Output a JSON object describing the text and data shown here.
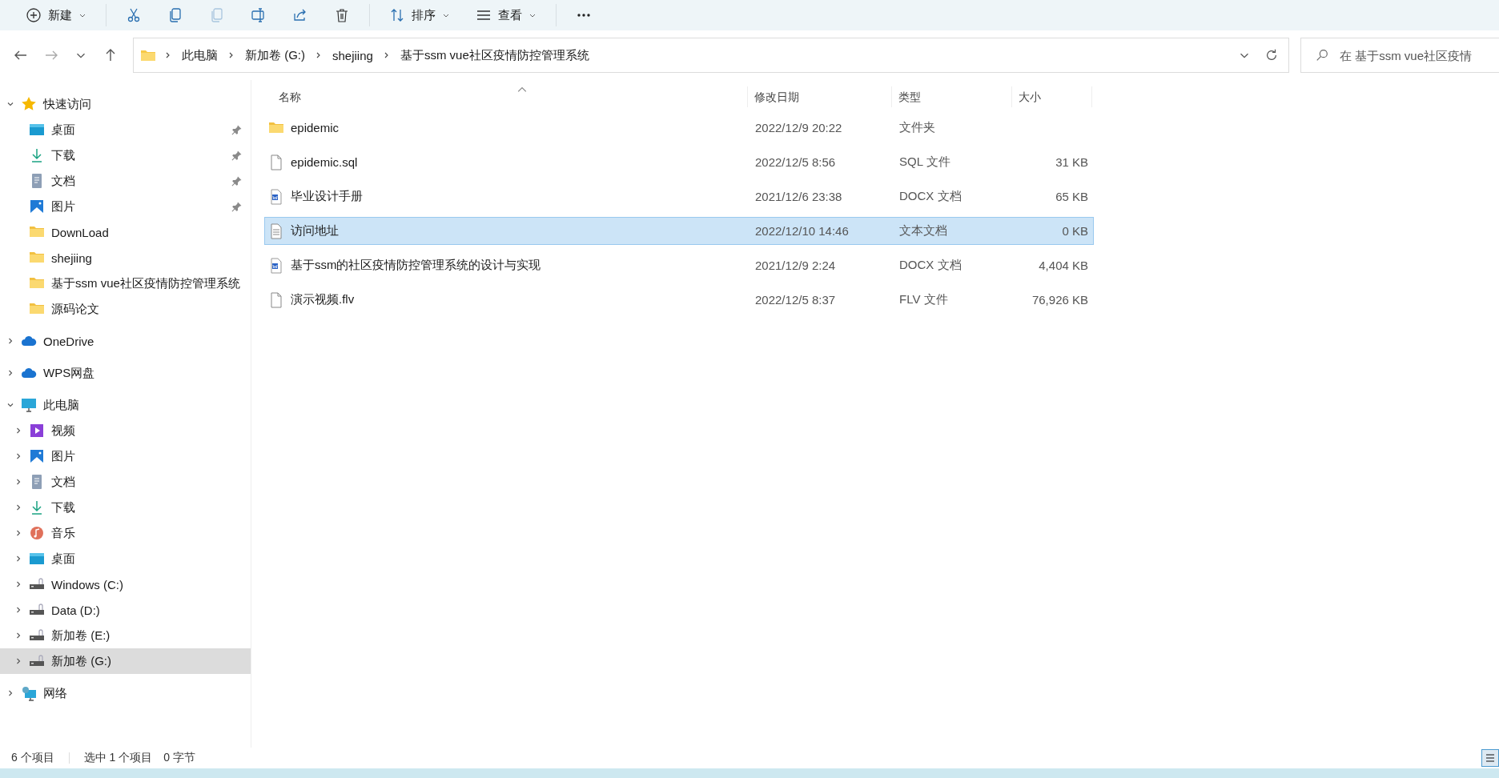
{
  "toolbar": {
    "items": [
      {
        "kind": "new",
        "label": "新建",
        "disabled": false
      },
      {
        "kind": "cut",
        "disabled": false
      },
      {
        "kind": "copy",
        "disabled": false
      },
      {
        "kind": "paste",
        "disabled": true
      },
      {
        "kind": "rename",
        "disabled": false
      },
      {
        "kind": "share",
        "disabled": false
      },
      {
        "kind": "delete",
        "disabled": false
      },
      {
        "kind": "sort",
        "label": "排序",
        "disabled": false
      },
      {
        "kind": "view",
        "label": "查看",
        "disabled": false
      },
      {
        "kind": "more",
        "disabled": false
      }
    ]
  },
  "address_bar": {
    "path": [
      "此电脑",
      "新加卷 (G:)",
      "shejiing",
      "基于ssm vue社区疫情防控管理系统"
    ]
  },
  "search": {
    "placeholder": "在 基于ssm vue社区疫情"
  },
  "sidebar": {
    "items": [
      {
        "label": "快速访问",
        "kind": "star",
        "expanded": true,
        "selected": false,
        "children": [
          {
            "label": "桌面",
            "kind": "desktop",
            "pinned": true,
            "selected": false
          },
          {
            "label": "下载",
            "kind": "download",
            "pinned": true,
            "selected": false
          },
          {
            "label": "文档",
            "kind": "document",
            "pinned": true,
            "selected": false
          },
          {
            "label": "图片",
            "kind": "picture",
            "pinned": true,
            "selected": false
          },
          {
            "label": "DownLoad",
            "kind": "folder",
            "pinned": false,
            "selected": false
          },
          {
            "label": "shejiing",
            "kind": "folder",
            "pinned": false,
            "selected": false
          },
          {
            "label": "基于ssm vue社区疫情防控管理系统",
            "kind": "folder",
            "pinned": false,
            "selected": false
          },
          {
            "label": "源码论文",
            "kind": "folder",
            "pinned": false,
            "selected": false
          }
        ]
      },
      {
        "label": "OneDrive",
        "kind": "cloud",
        "expanded": false,
        "selected": false
      },
      {
        "label": "WPS网盘",
        "kind": "cloud",
        "expanded": false,
        "selected": false
      },
      {
        "label": "此电脑",
        "kind": "pc",
        "expanded": true,
        "selected": false,
        "children": [
          {
            "label": "视频",
            "kind": "video",
            "expanded": false,
            "selected": false
          },
          {
            "label": "图片",
            "kind": "picture",
            "expanded": false,
            "selected": false
          },
          {
            "label": "文档",
            "kind": "document",
            "expanded": false,
            "selected": false
          },
          {
            "label": "下载",
            "kind": "download",
            "expanded": false,
            "selected": false
          },
          {
            "label": "音乐",
            "kind": "music",
            "expanded": false,
            "selected": false
          },
          {
            "label": "桌面",
            "kind": "desktop",
            "expanded": false,
            "selected": false
          },
          {
            "label": "Windows (C:)",
            "kind": "drive",
            "expanded": false,
            "selected": false
          },
          {
            "label": "Data (D:)",
            "kind": "drive",
            "expanded": false,
            "selected": false
          },
          {
            "label": "新加卷 (E:)",
            "kind": "drive",
            "expanded": false,
            "selected": false
          },
          {
            "label": "新加卷 (G:)",
            "kind": "drive",
            "expanded": false,
            "selected": true
          }
        ]
      },
      {
        "label": "网络",
        "kind": "network",
        "expanded": false,
        "selected": false
      }
    ]
  },
  "table": {
    "columns": [
      "名称",
      "修改日期",
      "类型",
      "大小"
    ],
    "rows": [
      {
        "kind": "folder",
        "name": "epidemic",
        "modified": "2022/12/9 20:22",
        "type": "文件夹",
        "size": "",
        "selected": false
      },
      {
        "kind": "file",
        "name": "epidemic.sql",
        "modified": "2022/12/5 8:56",
        "type": "SQL 文件",
        "size": "31 KB",
        "selected": false
      },
      {
        "kind": "docx",
        "name": "毕业设计手册",
        "modified": "2021/12/6 23:38",
        "type": "DOCX 文档",
        "size": "65 KB",
        "selected": false
      },
      {
        "kind": "text",
        "name": "访问地址",
        "modified": "2022/12/10 14:46",
        "type": "文本文档",
        "size": "0 KB",
        "selected": true
      },
      {
        "kind": "docx",
        "name": "基于ssm的社区疫情防控管理系统的设计与实现",
        "modified": "2021/12/9 2:24",
        "type": "DOCX 文档",
        "size": "4,404 KB",
        "selected": false
      },
      {
        "kind": "file",
        "name": "演示视频.flv",
        "modified": "2022/12/5 8:37",
        "type": "FLV 文件",
        "size": "76,926 KB",
        "selected": false
      }
    ]
  },
  "status_bar": {
    "item_count": "6 个项目",
    "selection": "选中 1 个项目",
    "selection_size": "0 字节",
    "details_view_selected": true
  }
}
